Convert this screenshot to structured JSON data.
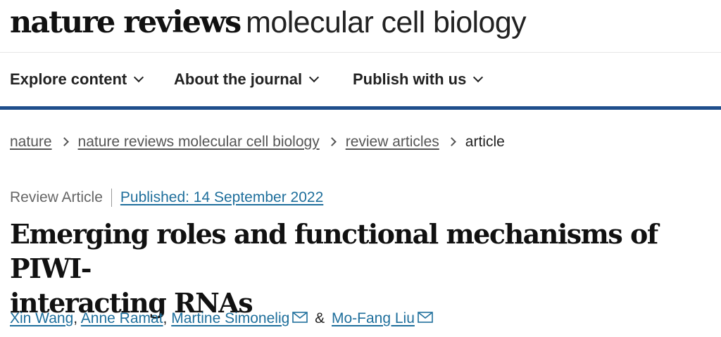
{
  "header": {
    "brand": "nature reviews",
    "journal": "molecular cell biology"
  },
  "nav": {
    "items": [
      {
        "label": "Explore content"
      },
      {
        "label": "About the journal"
      },
      {
        "label": "Publish with us"
      }
    ]
  },
  "breadcrumb": {
    "items": [
      {
        "label": "nature"
      },
      {
        "label": "nature reviews molecular cell biology"
      },
      {
        "label": "review articles"
      }
    ],
    "current": "article"
  },
  "article": {
    "type": "Review Article",
    "published": "Published: 14 September 2022",
    "title_line1": "Emerging roles and functional mechanisms of PIWI-",
    "title_line2": "interacting RNAs",
    "authors": [
      {
        "name": "Xin Wang",
        "sep": ","
      },
      {
        "name": "Anne Ramat",
        "sep": ","
      },
      {
        "name": "Martine Simonelig"
      },
      {
        "name": "Mo-Fang Liu"
      }
    ],
    "author_joiner": "&"
  },
  "colors": {
    "accent_bar": "#1f4e8c",
    "link": "#1f6f9c"
  }
}
